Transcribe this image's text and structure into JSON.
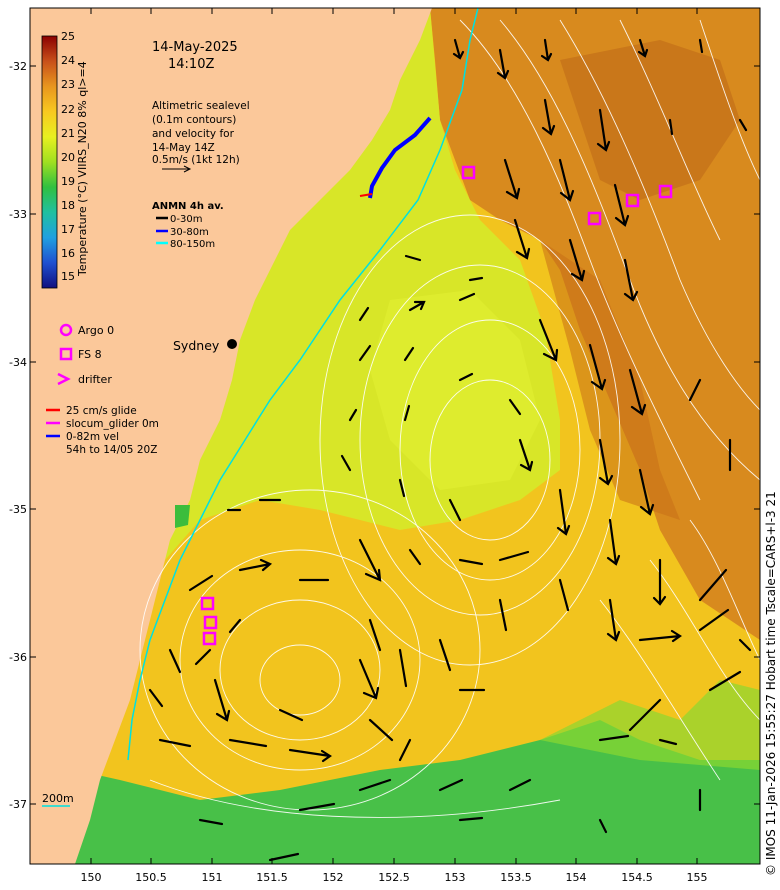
{
  "map": {
    "date": "14-May-2025",
    "time": "14:10Z",
    "altimetry_note": [
      "Altimetric sealevel",
      "(0.1m contours)",
      "and velocity for",
      "14-May 14Z",
      "0.5m/s (1kt 12h)"
    ],
    "anmn_title": "ANMN 4h av.",
    "anmn_items": [
      {
        "label": "0-30m",
        "color": "#000000"
      },
      {
        "label": "30-80m",
        "color": "#0000ff"
      },
      {
        "label": "80-150m",
        "color": "#00ffff"
      }
    ],
    "legend_items": [
      {
        "label": "Argo 0",
        "shape": "circle",
        "color": "#ff00ff"
      },
      {
        "label": "FS 8",
        "shape": "square",
        "color": "#ff00ff"
      },
      {
        "label": "drifter",
        "shape": "chevron",
        "color": "#ff00ff"
      }
    ],
    "glider_lines": [
      "25 cm/s glide",
      "slocum_glider 0m",
      "0-82m vel",
      "54h to 14/05 20Z"
    ],
    "city": "Sydney",
    "depth_label": "200m",
    "colorbar_label": "Temperature (°C) VIIRS_N20 8% ql>=4",
    "colorbar_ticks": [
      "25",
      "24",
      "23",
      "22",
      "21",
      "20",
      "19",
      "18",
      "17",
      "16",
      "15"
    ],
    "x_ticks": [
      "150",
      "150.5",
      "151",
      "151.5",
      "152",
      "152.5",
      "153",
      "153.5",
      "154",
      "154.5",
      "155"
    ],
    "y_ticks": [
      "-32",
      "-33",
      "-34",
      "-35",
      "-36",
      "-37"
    ],
    "credit": "© IMOS 11-Jan-2026 15:55:27 Hobart time Tscale=CARS+l-3 21",
    "colors": {
      "land": "#fbc89a",
      "warm_sst": "#d88a1e",
      "mid_sst": "#f0c020",
      "cool_sst": "#d8ea20",
      "shelf_sst": "#3cbd3c",
      "marker": "#ff00ff"
    }
  }
}
